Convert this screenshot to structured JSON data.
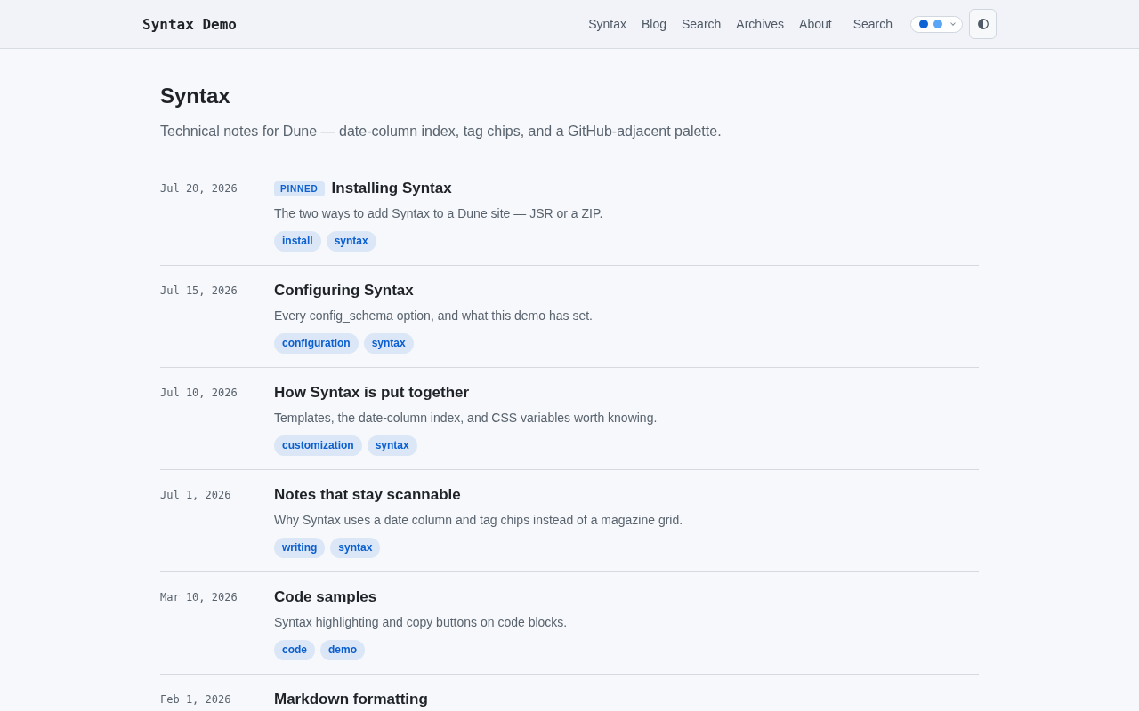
{
  "header": {
    "site_title": "Syntax Demo",
    "nav": [
      "Syntax",
      "Blog",
      "Search",
      "Archives",
      "About"
    ],
    "search": "Search",
    "palette": {
      "swatches": [
        {
          "color": "#0b63d6"
        },
        {
          "color": "#5aa5f5"
        }
      ]
    }
  },
  "page": {
    "title": "Syntax",
    "description": "Technical notes for Dune — date-column index, tag chips, and a GitHub-adjacent palette."
  },
  "posts": [
    {
      "date": "Jul 20, 2026",
      "badge": "PINNED",
      "title": "Installing Syntax",
      "summary": "The two ways to add Syntax to a Dune site — JSR or a ZIP.",
      "tags": [
        "install",
        "syntax"
      ]
    },
    {
      "date": "Jul 15, 2026",
      "title": "Configuring Syntax",
      "summary": "Every config_schema option, and what this demo has set.",
      "tags": [
        "configuration",
        "syntax"
      ]
    },
    {
      "date": "Jul 10, 2026",
      "title": "How Syntax is put together",
      "summary": "Templates, the date-column index, and CSS variables worth knowing.",
      "tags": [
        "customization",
        "syntax"
      ]
    },
    {
      "date": "Jul 1, 2026",
      "title": "Notes that stay scannable",
      "summary": "Why Syntax uses a date column and tag chips instead of a magazine grid.",
      "tags": [
        "writing",
        "syntax"
      ]
    },
    {
      "date": "Mar 10, 2026",
      "title": "Code samples",
      "summary": "Syntax highlighting and copy buttons on code blocks.",
      "tags": [
        "code",
        "demo"
      ]
    },
    {
      "date": "Feb 1, 2026",
      "title": "Markdown formatting"
    }
  ]
}
